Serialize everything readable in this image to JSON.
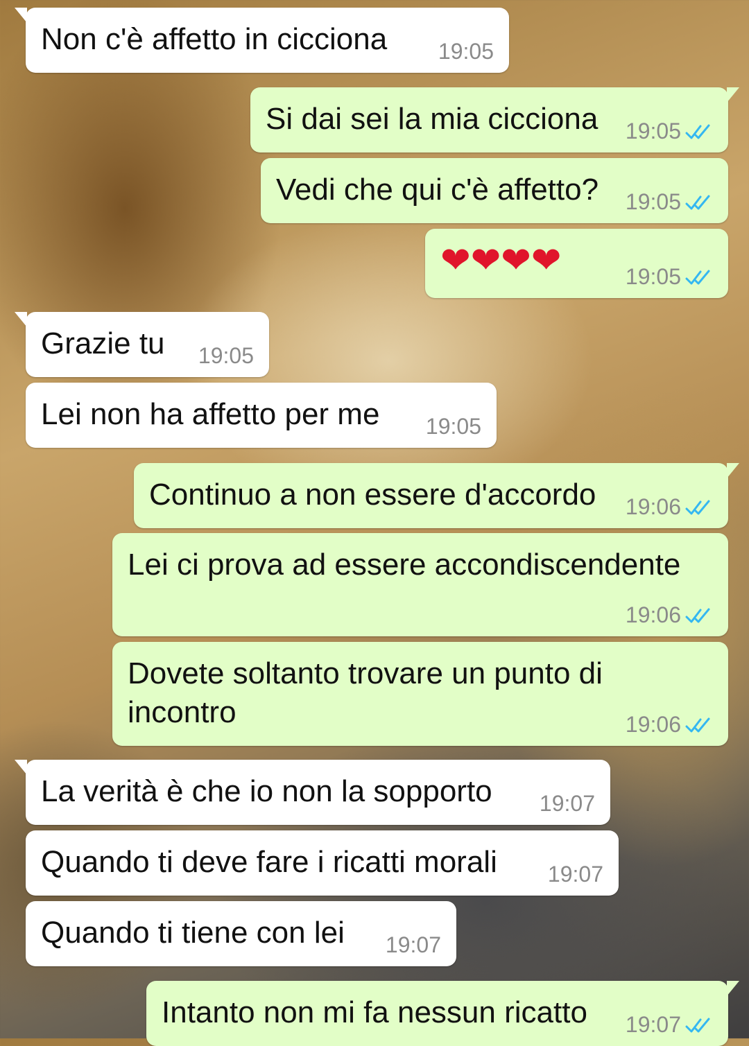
{
  "messages": [
    {
      "direction": "in",
      "text": "Non c'è affetto in cicciona",
      "time": "19:05"
    },
    {
      "direction": "out",
      "text": "Si dai sei la mia cicciona",
      "time": "19:05",
      "status": "read"
    },
    {
      "direction": "out",
      "text": "Vedi che qui c'è affetto?",
      "time": "19:05",
      "status": "read"
    },
    {
      "direction": "out",
      "text": "❤❤❤❤",
      "time": "19:05",
      "status": "read"
    },
    {
      "direction": "in",
      "text": "Grazie tu",
      "time": "19:05"
    },
    {
      "direction": "in",
      "text": "Lei non ha affetto per me",
      "time": "19:05"
    },
    {
      "direction": "out",
      "text": "Continuo a non essere d'accordo",
      "time": "19:06",
      "status": "read"
    },
    {
      "direction": "out",
      "text": "Lei ci prova ad essere accondiscendente",
      "time": "19:06",
      "status": "read"
    },
    {
      "direction": "out",
      "text": "Dovete soltanto trovare un punto di incontro",
      "time": "19:06",
      "status": "read"
    },
    {
      "direction": "in",
      "text": "La verità è che io non la sopporto",
      "time": "19:07"
    },
    {
      "direction": "in",
      "text": "Quando ti deve fare i ricatti morali",
      "time": "19:07"
    },
    {
      "direction": "in",
      "text": "Quando ti tiene con lei",
      "time": "19:07"
    },
    {
      "direction": "out",
      "text": "Intanto non mi fa nessun ricatto",
      "time": "19:07",
      "status": "read"
    }
  ],
  "colors": {
    "incoming": "#ffffff",
    "outgoing": "#e2fec7",
    "read_ticks": "#34b7f1",
    "heart": "#e0142b"
  },
  "icons": {
    "read_receipt": "double-check-icon"
  }
}
